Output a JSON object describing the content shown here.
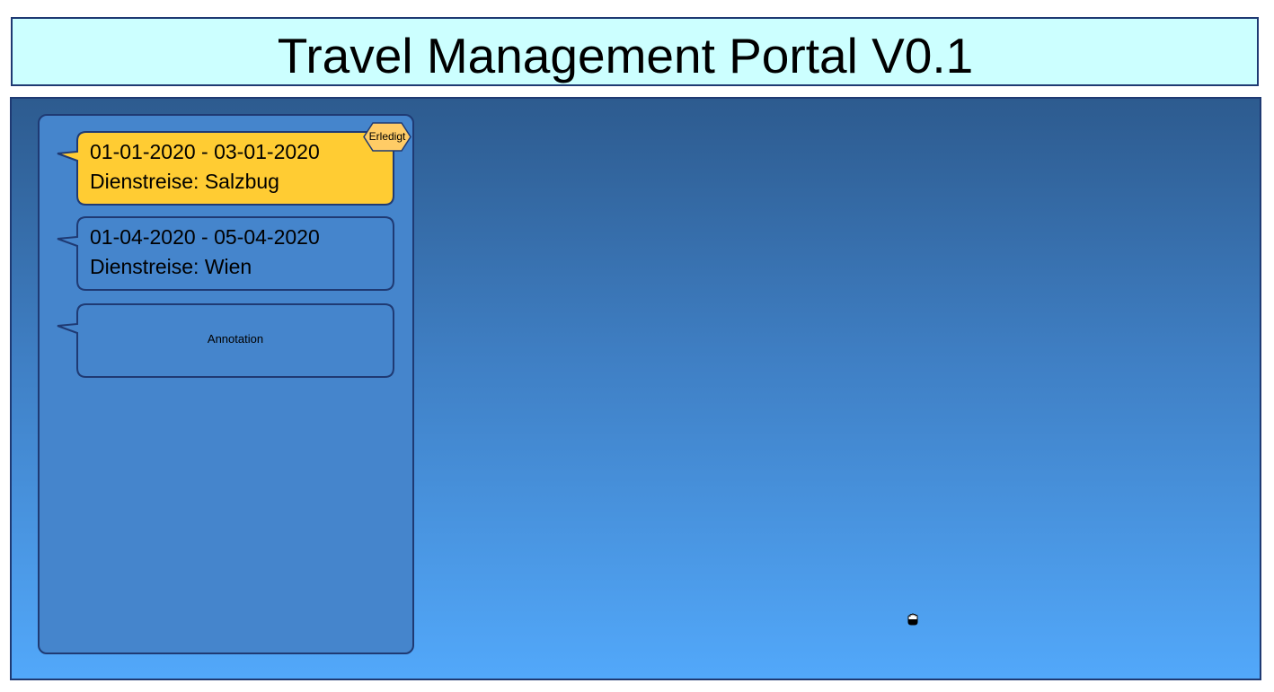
{
  "header": {
    "title": "Travel Management Portal V0.1"
  },
  "trips": [
    {
      "date_range": "01-01-2020 - 03-01-2020",
      "description": "Dienstreise: Salzbug",
      "status": "Erledigt",
      "fill_color": "#ffcc33"
    },
    {
      "date_range": "01-04-2020 - 05-04-2020",
      "description": "Dienstreise: Wien",
      "fill_color": "#4585cc"
    }
  ],
  "annotation": {
    "label": "Annotation",
    "fill_color": "#4585cc"
  },
  "colors": {
    "header_bg": "#ccffff",
    "border": "#1f3a73",
    "panel_bg": "#4585cc",
    "workspace_top": "#2d5b8f",
    "workspace_bottom": "#52a8fa",
    "badge_bg": "#ffcc66"
  },
  "icons": {
    "cursor": "grab-hand-icon",
    "status": "hexagon-badge-icon"
  }
}
